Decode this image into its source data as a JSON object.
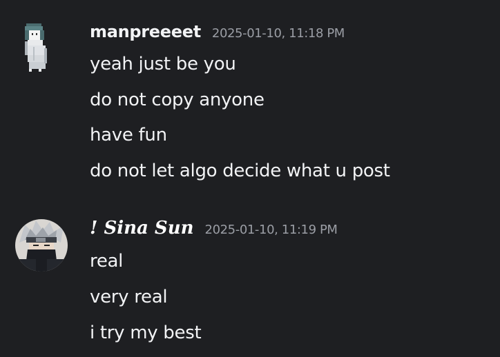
{
  "chat": {
    "messages": [
      {
        "author": "manpreeeet",
        "timestamp": "2025-01-10, 11:18 PM",
        "avatar_icon": "pixel-art-ghost-girl-icon",
        "lines": [
          "yeah just be you",
          "do not copy anyone",
          "have fun",
          "do not let algo decide what u post"
        ]
      },
      {
        "author": "! Sina Sun",
        "timestamp": "2025-01-10, 11:19 PM",
        "avatar_icon": "masked-ninja-avatar-icon",
        "lines": [
          "real",
          "very real",
          "i try my best"
        ]
      }
    ]
  },
  "colors": {
    "background": "#1e1f22",
    "text": "#f2f3f5",
    "timestamp": "#9b9ea5"
  }
}
